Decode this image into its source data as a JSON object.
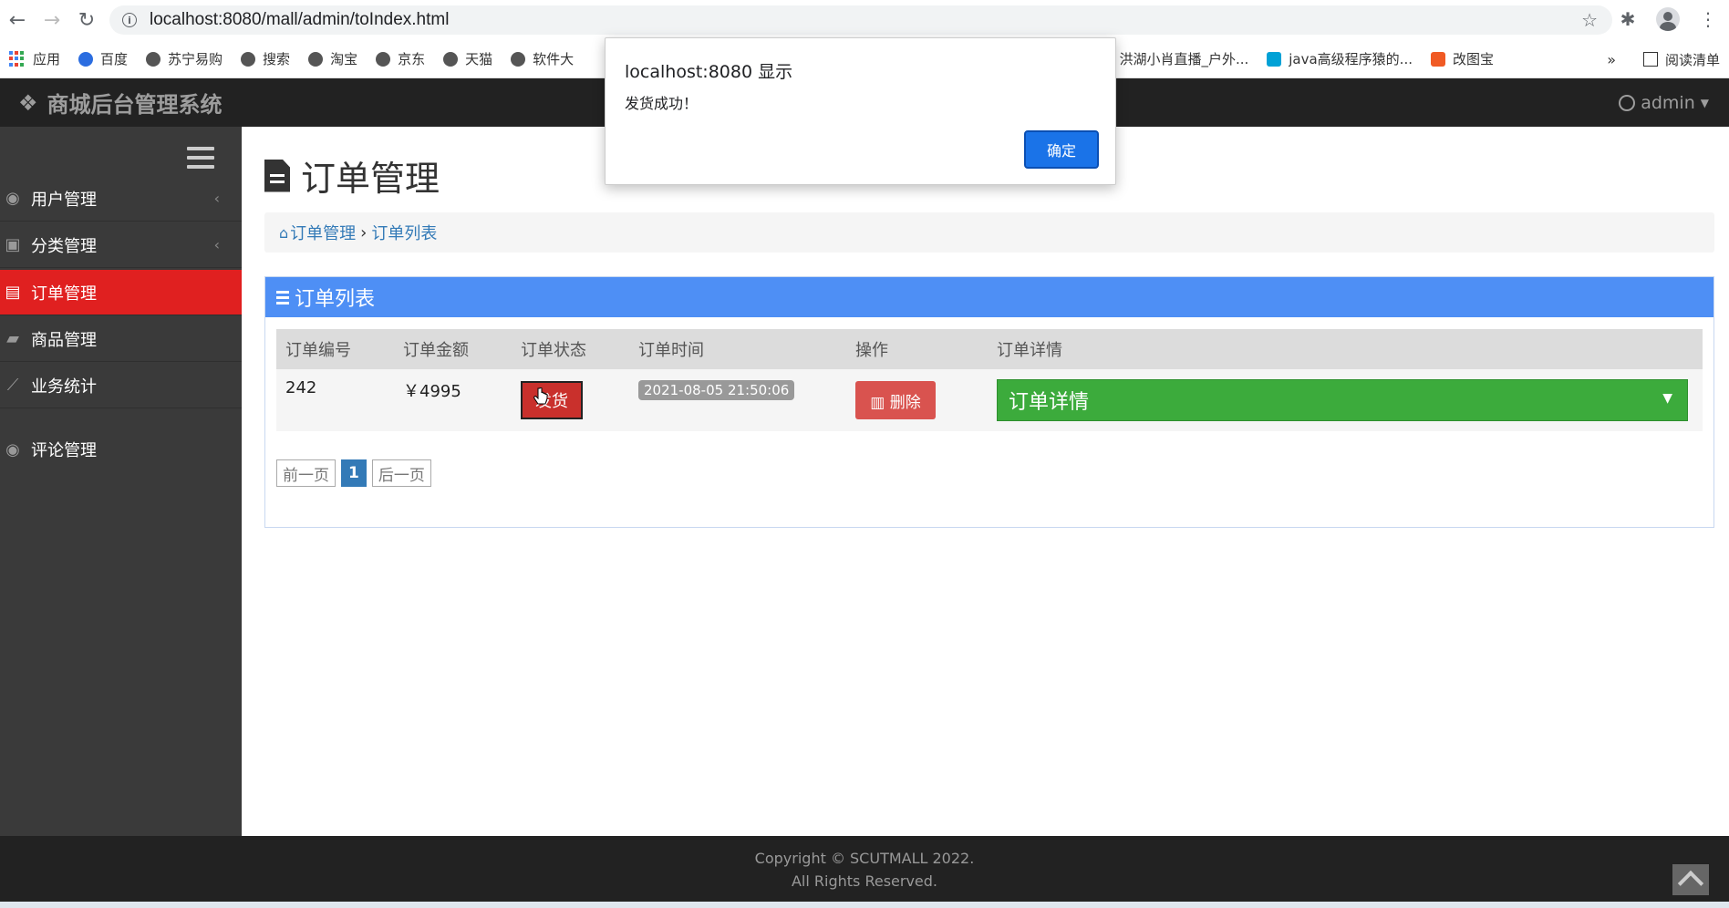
{
  "browser": {
    "url": "localhost:8080/mall/admin/toIndex.html",
    "bookmarks": [
      "应用",
      "百度",
      "苏宁易购",
      "搜索",
      "淘宝",
      "京东",
      "天猫",
      "软件大",
      "...",
      "洪湖小肖直播_户外...",
      "java高级程序猿的...",
      "改图宝"
    ],
    "bookmarks_more": "»",
    "reading_list": "阅读清单"
  },
  "app": {
    "brand": "商城后台管理系统",
    "user": "admin"
  },
  "sidebar": {
    "items": [
      {
        "label": "用户管理",
        "icon": "user-icon"
      },
      {
        "label": "分类管理",
        "icon": "category-icon"
      },
      {
        "label": "订单管理",
        "icon": "file-icon"
      },
      {
        "label": "商品管理",
        "icon": "bag-icon"
      },
      {
        "label": "业务统计",
        "icon": "chart-icon"
      },
      {
        "label": "评论管理",
        "icon": "user-icon"
      }
    ]
  },
  "main": {
    "title": "订单管理",
    "breadcrumb": {
      "root": "订单管理",
      "sep": "›",
      "current": "订单列表"
    },
    "panel_title": "订单列表",
    "table": {
      "headers": [
        "订单编号",
        "订单金额",
        "订单状态",
        "订单时间",
        "操作",
        "订单详情"
      ],
      "rows": [
        {
          "id": "242",
          "amount": "￥4995",
          "status_btn": "发货",
          "time": "2021-08-05 21:50:06",
          "delete_btn": "删除",
          "detail": "订单详情"
        }
      ]
    },
    "pager": {
      "prev": "前一页",
      "current": "1",
      "next": "后一页"
    }
  },
  "footer": {
    "line1": "Copyright © SCUTMALL 2022.",
    "line2": "All Rights Reserved."
  },
  "dialog": {
    "title": "localhost:8080 显示",
    "message": "发货成功！",
    "ok": "确定"
  },
  "colors": {
    "sidebar_active": "#e02020",
    "panel_heading": "#4e8ff5",
    "detail_bar": "#3cab3c",
    "dialog_ok": "#1a73e8"
  }
}
